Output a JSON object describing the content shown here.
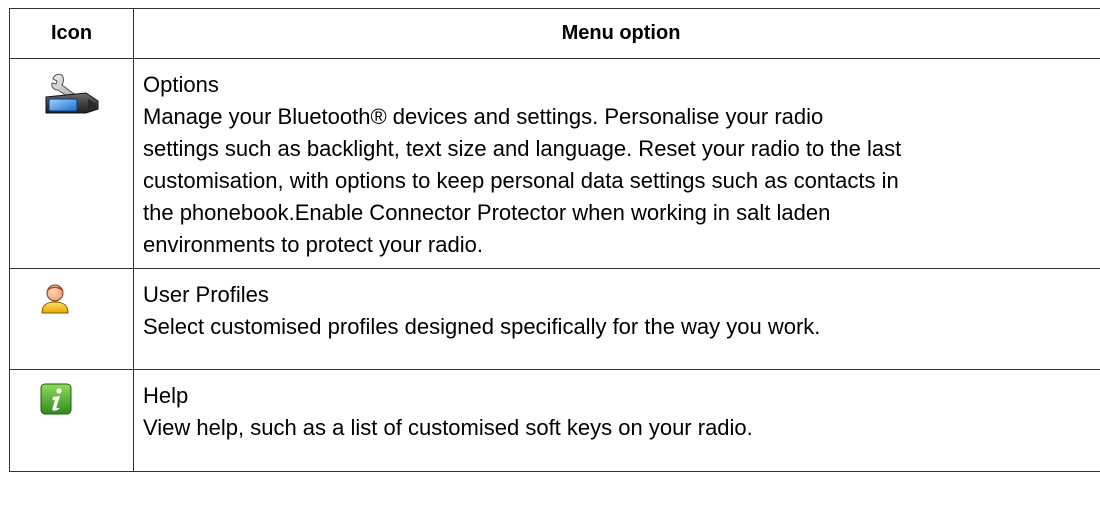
{
  "table": {
    "headers": {
      "icon": "Icon",
      "menu_option": "Menu option"
    },
    "rows": [
      {
        "icon": "wrench-radio-icon",
        "title": "Options",
        "description": "Manage your Bluetooth® devices and settings. Personalise your radio\nsettings such as backlight, text size and language. Reset your radio to the last\ncustomisation, with options to keep personal data settings such as contacts in\nthe phonebook.Enable Connector Protector when working in salt laden\nenvironments to protect your radio."
      },
      {
        "icon": "user-profile-icon",
        "title": "User Profiles",
        "description": "Select customised profiles designed specifically for the way you work."
      },
      {
        "icon": "info-help-icon",
        "title": "Help",
        "description": "View help, such as a list of customised soft keys on your radio."
      }
    ]
  }
}
